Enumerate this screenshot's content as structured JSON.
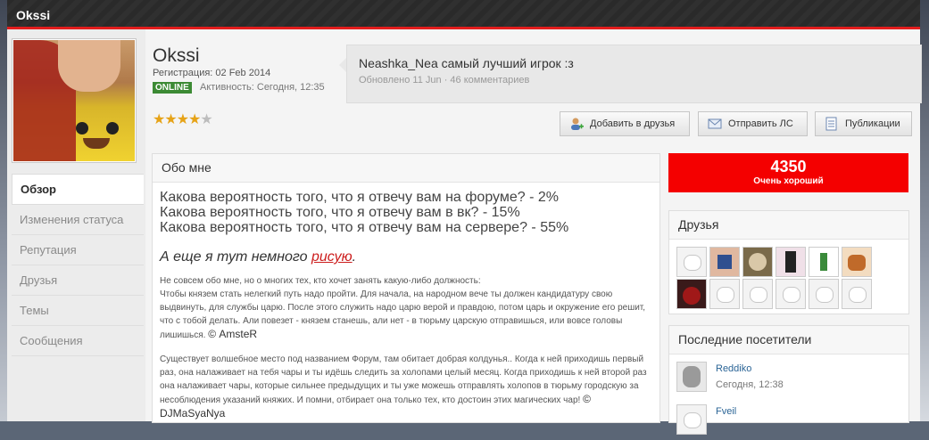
{
  "header": {
    "title": "Okssi"
  },
  "profile": {
    "name": "Okssi",
    "registration": "Регистрация: 02 Feb 2014",
    "online_badge": "ONLINE",
    "activity": "Активность: Сегодня, 12:35",
    "rating_stars": 4,
    "rating_max": 5
  },
  "status": {
    "text": "Neashka_Nea самый лучший игрок :з",
    "meta": "Обновлено 11 Jun · 46 комментариев"
  },
  "buttons": {
    "add_friend": "Добавить в друзья",
    "send_pm": "Отправить ЛС",
    "publications": "Публикации"
  },
  "sidebar": {
    "items": [
      {
        "label": "Обзор",
        "active": true
      },
      {
        "label": "Изменения статуса",
        "active": false
      },
      {
        "label": "Репутация",
        "active": false
      },
      {
        "label": "Друзья",
        "active": false
      },
      {
        "label": "Темы",
        "active": false
      },
      {
        "label": "Сообщения",
        "active": false
      }
    ]
  },
  "about": {
    "title": "Обо мне",
    "lines": [
      "Какова вероятность того, что я отвечу вам на форуме? - 2%",
      "Какова вероятность того, что я отвечу вам в вк? - 15%",
      "Какова вероятность того, что я отвечу вам на сервере? - 55%"
    ],
    "italic_prefix": "А еще я тут немного ",
    "italic_link": "рисую",
    "italic_suffix": ".",
    "para1_intro": "Не совсем обо мне, но о многих тех, кто хочет занять какую-либо должность:",
    "para1": "Чтобы князем стать нелегкий путь надо пройти. Для начала, на народном вече ты должен кандидатуру свою выдвинуть, для службы царю. После этого служить надо царю верой и правдою, потом царь и окружение его решит, что с тобой делать. Али повезет - князем станешь, али нет - в тюрьму царскую отправишься, или вовсе головы лишишься.",
    "sig1": "© AmsteR",
    "para2": "Существует волшебное место под названием Форум, там обитает добрая колдунья.. Когда к ней приходишь первый раз, она налаживает на тебя чары и ты идёшь следить за холопами целый месяц. Когда приходишь к ней второй раз она налаживает чары, которые сильнее предыдущих и ты уже можешь отправлять холопов в тюрьму городскую за несоблюдения указаний княжих. И помни, отбирает она только тех, кто достоин этих магических чар!",
    "sig2": "© DJMaSyaNya"
  },
  "reputation": {
    "value": "4350",
    "label": "Очень хороший",
    "color": "#f40000"
  },
  "friends": {
    "title": "Друзья",
    "avatars": [
      "default-avatar-icon",
      "pixel-avatar-icon",
      "cat-avatar-icon",
      "anime-avatar-icon",
      "minecraft-avatar-icon",
      "fox-avatar-icon",
      "red-avatar-icon",
      "default-avatar-icon",
      "default-avatar-icon",
      "default-avatar-icon",
      "default-avatar-icon",
      "default-avatar-icon"
    ]
  },
  "visitors": {
    "title": "Последние посетители",
    "items": [
      {
        "name": "Reddiko",
        "time": "Сегодня, 12:38"
      },
      {
        "name": "Fveil",
        "time": ""
      }
    ]
  }
}
